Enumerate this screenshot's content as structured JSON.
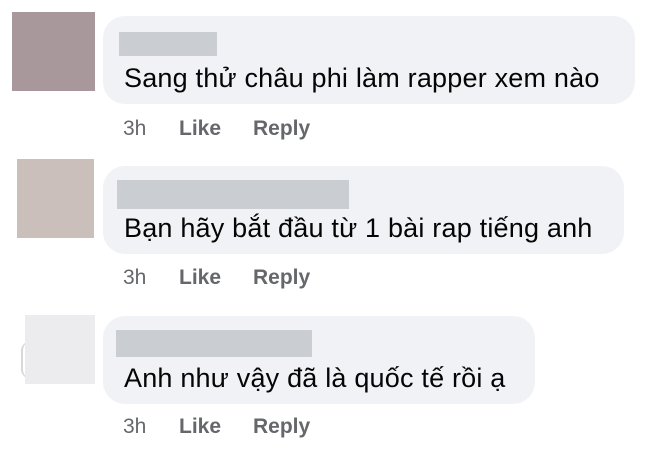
{
  "comments": [
    {
      "text": "Sang thử châu phi làm rapper xem nào",
      "time": "3h",
      "like_label": "Like",
      "reply_label": "Reply",
      "avatar_color": "#a8979b"
    },
    {
      "text": "Bạn hãy bắt đầu từ 1 bài rap tiếng anh",
      "time": "3h",
      "like_label": "Like",
      "reply_label": "Reply",
      "avatar_color": "#cabfba"
    },
    {
      "text": "Anh như vậy đã là quốc tế rồi ạ",
      "time": "3h",
      "like_label": "Like",
      "reply_label": "Reply",
      "avatar_color": "#ececee"
    }
  ],
  "colors": {
    "bubble_bg": "#f0f2f5",
    "redaction": "#cacdd2",
    "meta_text": "#65676b",
    "comment_text": "#050505"
  }
}
